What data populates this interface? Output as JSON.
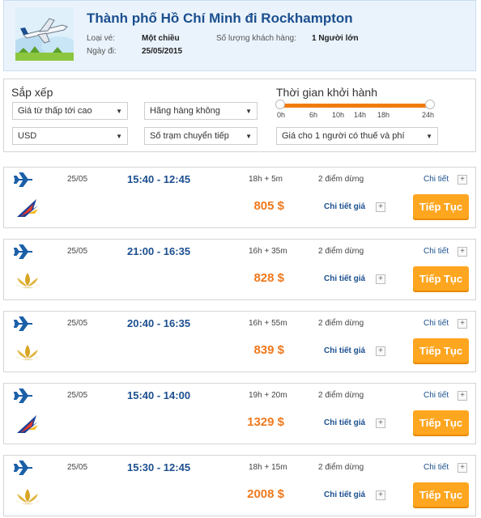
{
  "header": {
    "title": "Thành phố Hồ Chí Minh đi Rockhampton",
    "trip_type_label": "Loại vé:",
    "trip_type_value": "Một chiều",
    "passengers_label": "Số lượng khách hàng:",
    "passengers_value": "1 Người lớn",
    "date_label": "Ngày đi:",
    "date_value": "25/05/2015"
  },
  "filters": {
    "sort_title": "Sắp xếp",
    "sort_value": "Giá từ thấp tới cao",
    "airline_value": "Hãng hàng không",
    "currency_value": "USD",
    "transfer_value": "Số trạm chuyển tiếp",
    "departure_title": "Thời gian khởi hành",
    "price_display_value": "Giá cho 1 người có thuế và phí",
    "ticks": [
      "0h",
      "6h",
      "10h",
      "14h",
      "18h",
      "24h"
    ],
    "slider_range_hours": [
      0,
      24
    ]
  },
  "labels": {
    "detail": "Chi tiết",
    "price_detail": "Chi tiết giá",
    "continue": "Tiếp Tục"
  },
  "flights": [
    {
      "date": "25/05",
      "time": "15:40 - 12:45",
      "duration": "18h + 5m",
      "stops": "2 điểm dừng",
      "price": "805 $",
      "airline_logo": "swallow-airline-logo"
    },
    {
      "date": "25/05",
      "time": "21:00 - 16:35",
      "duration": "16h + 35m",
      "stops": "2 điểm dừng",
      "price": "828 $",
      "airline_logo": "lotus-airline-logo"
    },
    {
      "date": "25/05",
      "time": "20:40 - 16:35",
      "duration": "16h + 55m",
      "stops": "2 điểm dừng",
      "price": "839 $",
      "airline_logo": "lotus-airline-logo"
    },
    {
      "date": "25/05",
      "time": "15:40 - 14:00",
      "duration": "19h + 20m",
      "stops": "2 điểm dừng",
      "price": "1329 $",
      "airline_logo": "swallow-airline-logo"
    },
    {
      "date": "25/05",
      "time": "15:30 - 12:45",
      "duration": "18h + 15m",
      "stops": "2 điểm dừng",
      "price": "2008 $",
      "airline_logo": "lotus-airline-logo"
    }
  ],
  "colors": {
    "title_blue": "#1b4f8f",
    "price_orange": "#f0791d",
    "button_orange": "#ffa620",
    "slider_orange": "#f27b0f"
  }
}
